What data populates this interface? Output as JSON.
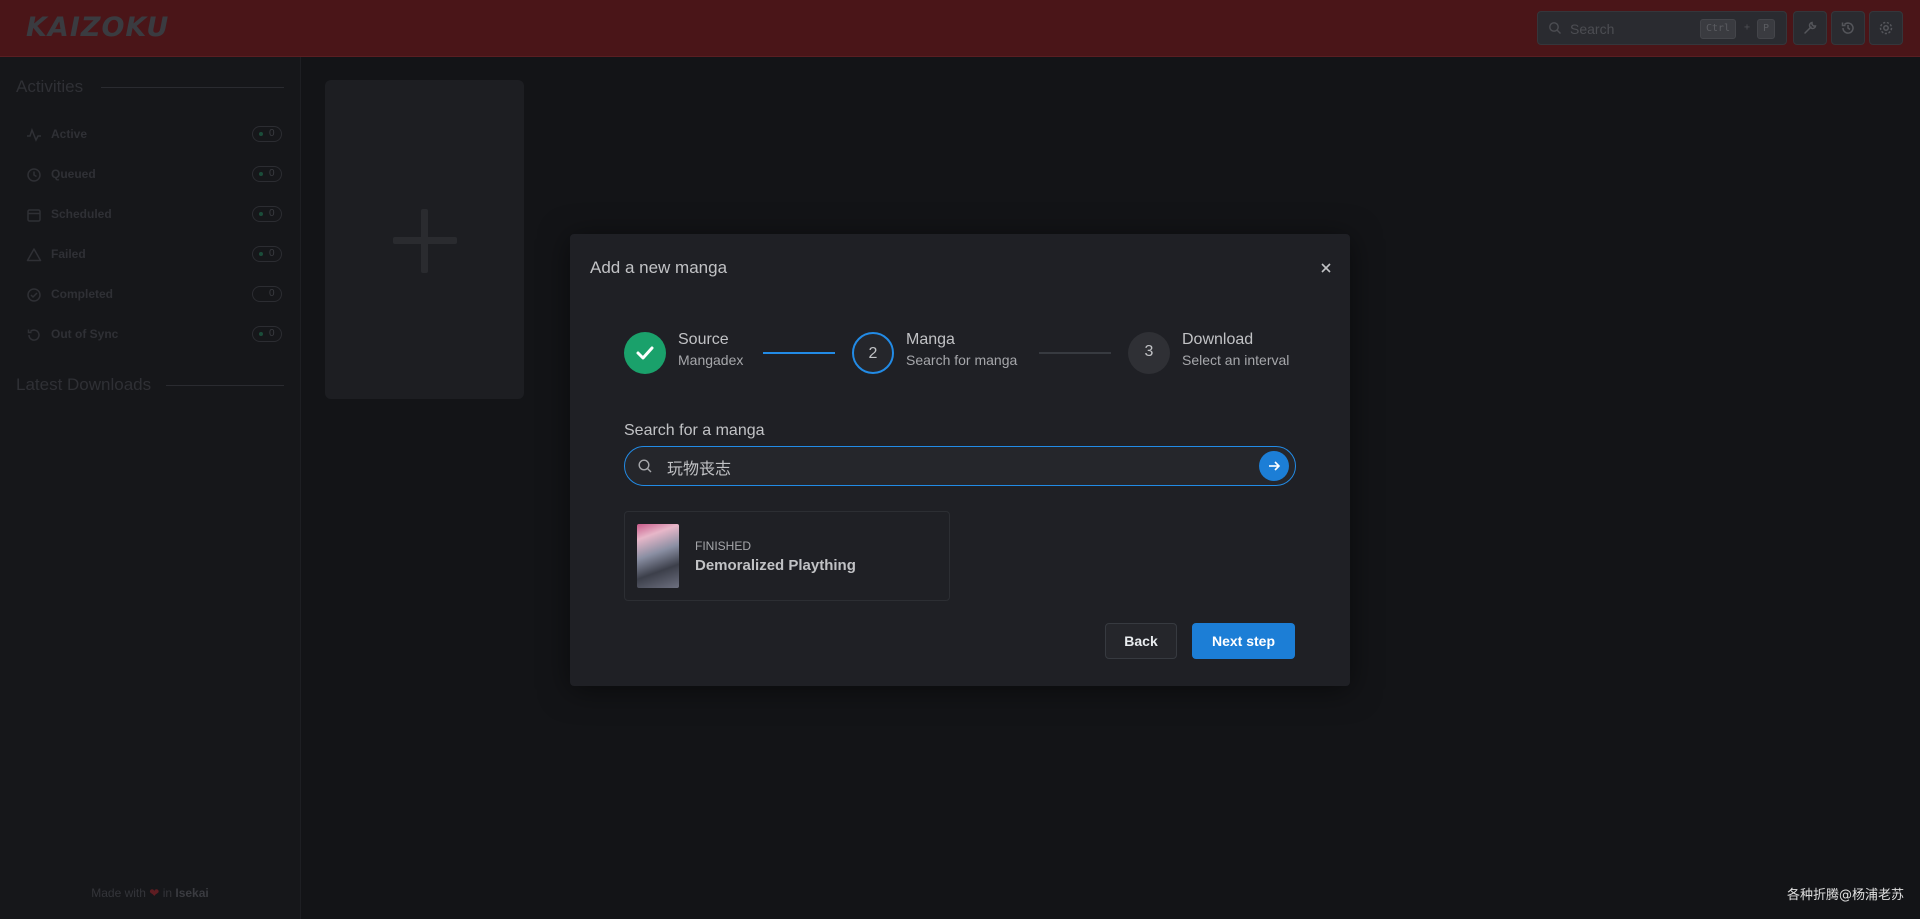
{
  "app": {
    "logo": "KAIZOKU"
  },
  "header": {
    "search_placeholder": "Search",
    "kbd_ctrl": "Ctrl",
    "kbd_plus": "+",
    "kbd_key": "P",
    "icons": [
      "wrench-icon",
      "history-icon",
      "gear-icon"
    ]
  },
  "sidebar": {
    "activities_title": "Activities",
    "activities": [
      {
        "label": "Active",
        "count": "0",
        "icon": "activity-icon"
      },
      {
        "label": "Queued",
        "count": "0",
        "icon": "clock-icon"
      },
      {
        "label": "Scheduled",
        "count": "0",
        "icon": "calendar-icon"
      },
      {
        "label": "Failed",
        "count": "0",
        "icon": "alert-triangle-icon"
      },
      {
        "label": "Completed",
        "count": "0",
        "icon": "check-circle-icon"
      },
      {
        "label": "Out of Sync",
        "count": "0",
        "icon": "sync-icon"
      }
    ],
    "latest_title": "Latest Downloads",
    "footer_prefix": "Made with",
    "footer_in": "in",
    "footer_brand": "Isekai"
  },
  "modal": {
    "title": "Add a new manga",
    "steps": [
      {
        "label": "Source",
        "description": "Mangadex",
        "state": "completed"
      },
      {
        "label": "Manga",
        "description": "Search for manga",
        "number": "2",
        "state": "active"
      },
      {
        "label": "Download",
        "description": "Select an interval",
        "number": "3",
        "state": "pending"
      }
    ],
    "search_label": "Search for a manga",
    "search_value": "玩物丧志",
    "result": {
      "status": "FINISHED",
      "title": "Demoralized Plaything"
    },
    "back_label": "Back",
    "next_label": "Next step"
  },
  "colors": {
    "accent": "#228be6",
    "success": "#1aa16b",
    "header_bg": "#4a1518"
  },
  "watermark": "各种折腾@杨浦老苏"
}
